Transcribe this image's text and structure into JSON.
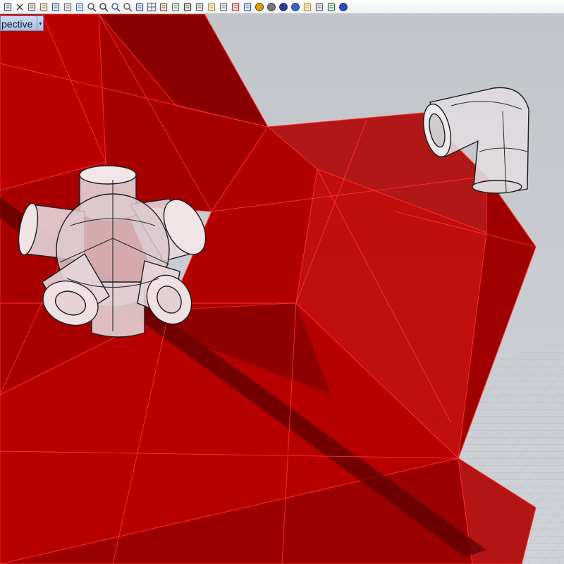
{
  "viewport": {
    "name": "Perspective",
    "visible_label": "pective",
    "menu_arrow_glyph": "▾"
  },
  "toolbar": {
    "buttons": [
      "new-file-icon",
      "cut-icon",
      "copy-icon",
      "paste-icon",
      "undo-icon",
      "pan-icon",
      "rotate-view-icon",
      "zoom-window-icon",
      "zoom-dynamic-icon",
      "zoom-extents-icon",
      "zoom-selected-icon",
      "redo-view-icon",
      "four-viewports-icon",
      "cplane-icon",
      "object-snap-icon",
      "select-icon",
      "point-icon",
      "light-icon",
      "lock-icon",
      "layer-icon",
      "properties-icon",
      "color-icon",
      "sphere-shaded-icon",
      "render-sphere-icon",
      "materials-icon",
      "options-icon",
      "settings-gear-icon",
      "commands-icon",
      "help-icon"
    ]
  },
  "colors": {
    "toolbar_bg": "#eef0f3",
    "viewport_bg": "#c8cbd0",
    "grid_line": "#b7bac0",
    "surface_red": "#c00000",
    "surface_edge": "#ff2020",
    "pipe_fill": "#e7d6da",
    "pipe_edge": "#202020"
  }
}
